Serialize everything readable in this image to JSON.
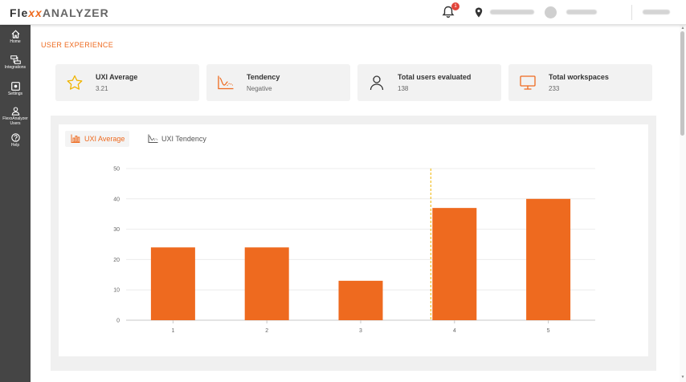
{
  "app": {
    "logo_main": "Fle",
    "logo_x": "xx",
    "logo_rest": "ANALYZER",
    "notification_count": "1",
    "accent_color": "#ee6a1f"
  },
  "sidebar": {
    "items": [
      {
        "label": "Home",
        "icon": "home-icon"
      },
      {
        "label": "Integrations",
        "icon": "integrations-icon"
      },
      {
        "label": "Settings",
        "icon": "settings-icon"
      },
      {
        "label": "FlexxAnalyzer Users",
        "icon": "user-icon"
      },
      {
        "label": "Help",
        "icon": "help-icon"
      }
    ]
  },
  "page": {
    "title": "USER EXPERIENCE"
  },
  "cards": [
    {
      "title": "UXI Average",
      "value": "3.21",
      "icon": "star-icon"
    },
    {
      "title": "Tendency",
      "value": "Negative",
      "icon": "tendency-chart-icon"
    },
    {
      "title": "Total users evaluated",
      "value": "138",
      "icon": "person-icon"
    },
    {
      "title": "Total workspaces",
      "value": "233",
      "icon": "monitor-icon"
    }
  ],
  "tabs": [
    {
      "label": "UXI Average",
      "active": true
    },
    {
      "label": "UXI Tendency",
      "active": false
    }
  ],
  "chart_data": {
    "type": "bar",
    "categories": [
      "1",
      "2",
      "3",
      "4",
      "5"
    ],
    "values": [
      24,
      24,
      13,
      37,
      40
    ],
    "ylim": [
      0,
      50
    ],
    "yticks": [
      0,
      10,
      20,
      30,
      40,
      50
    ],
    "bar_color": "#ee6a1f",
    "marker_line_at_category": "4",
    "marker_line_color": "#f0b400",
    "grid": true
  }
}
